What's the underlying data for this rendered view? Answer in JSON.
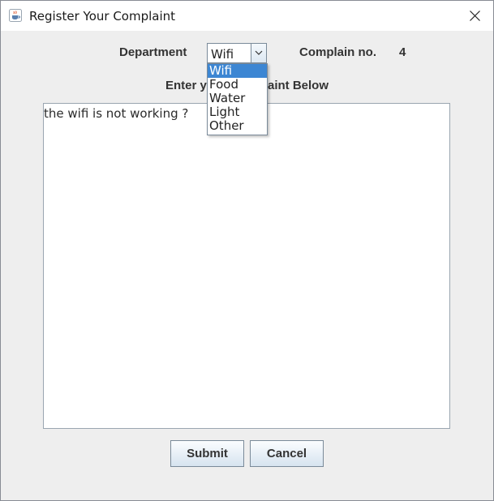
{
  "window": {
    "title": "Register Your Complaint",
    "app_icon": "java-cup-icon",
    "close_icon": "close-icon"
  },
  "form": {
    "department_label": "Department",
    "department_selected": "Wifi",
    "department_options": [
      "Wifi",
      "Food",
      "Water",
      "Light",
      "Other"
    ],
    "complain_no_label": "Complain no.",
    "complain_no_value": "4",
    "instruction_prefix": "Enter y",
    "instruction_suffix": "aint Below",
    "complaint_text": "the wifi is not working ?"
  },
  "buttons": {
    "submit": "Submit",
    "cancel": "Cancel"
  },
  "colors": {
    "selection": "#3c86d3",
    "window_bg": "#eeeeee"
  }
}
